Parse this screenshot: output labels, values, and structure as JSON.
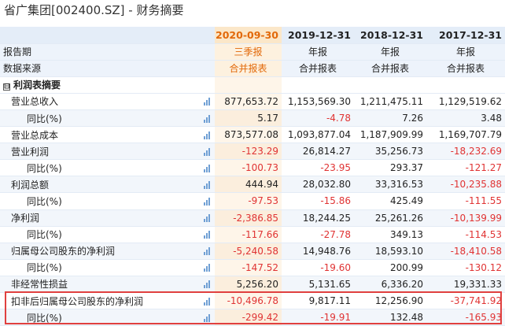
{
  "page_title": "省广集团[002400.SZ] - 财务摘要",
  "periods": [
    "2020-09-30",
    "2019-12-31",
    "2018-12-31",
    "2017-12-31"
  ],
  "report_period_label": "报告期",
  "report_periods": [
    "三季报",
    "年报",
    "年报",
    "年报"
  ],
  "data_source_label": "数据来源",
  "data_sources": [
    "合并报表",
    "合并报表",
    "合并报表",
    "合并报表"
  ],
  "section": {
    "toggle": "⊟",
    "title": "利润表摘要"
  },
  "rows": [
    {
      "label": "营业总收入",
      "values": [
        "877,653.72",
        "1,153,569.30",
        "1,211,475.11",
        "1,129,519.62"
      ]
    },
    {
      "label": "同比(%)",
      "values": [
        "5.17",
        "-4.78",
        "7.26",
        "3.48"
      ]
    },
    {
      "label": "营业总成本",
      "values": [
        "873,577.08",
        "1,093,877.04",
        "1,187,909.99",
        "1,169,707.79"
      ]
    },
    {
      "label": "营业利润",
      "values": [
        "-123.29",
        "26,814.27",
        "35,256.73",
        "-18,232.69"
      ]
    },
    {
      "label": "同比(%)",
      "values": [
        "-100.73",
        "-23.95",
        "293.37",
        "-121.27"
      ]
    },
    {
      "label": "利润总额",
      "values": [
        "444.94",
        "28,032.80",
        "33,316.53",
        "-10,235.88"
      ]
    },
    {
      "label": "同比(%)",
      "values": [
        "-97.53",
        "-15.86",
        "425.49",
        "-111.55"
      ]
    },
    {
      "label": "净利润",
      "values": [
        "-2,386.85",
        "18,244.25",
        "25,261.26",
        "-10,139.99"
      ]
    },
    {
      "label": "同比(%)",
      "values": [
        "-117.66",
        "-27.78",
        "349.13",
        "-114.53"
      ]
    },
    {
      "label": "归属母公司股东的净利润",
      "values": [
        "-5,240.58",
        "14,948.76",
        "18,593.10",
        "-18,410.58"
      ]
    },
    {
      "label": "同比(%)",
      "values": [
        "-147.52",
        "-19.60",
        "200.99",
        "-130.12"
      ]
    },
    {
      "label": "非经常性损益",
      "values": [
        "5,256.20",
        "5,131.65",
        "6,336.20",
        "19,331.33"
      ]
    },
    {
      "label": "扣非后归属母公司股东的净利润",
      "values": [
        "-10,496.78",
        "9,817.11",
        "12,256.90",
        "-37,741.92"
      ]
    },
    {
      "label": "同比(%)",
      "values": [
        "-299.42",
        "-19.91",
        "132.48",
        "-165.93"
      ]
    }
  ],
  "colors": {
    "negative": "#e03333",
    "highlight_period": "#e2690a",
    "header_bg": "#e4edf8",
    "highlight_box": "#e0403f",
    "chart_icon": "#6f9fd4"
  },
  "icons": {
    "row_chart": "bar-chart-icon"
  }
}
